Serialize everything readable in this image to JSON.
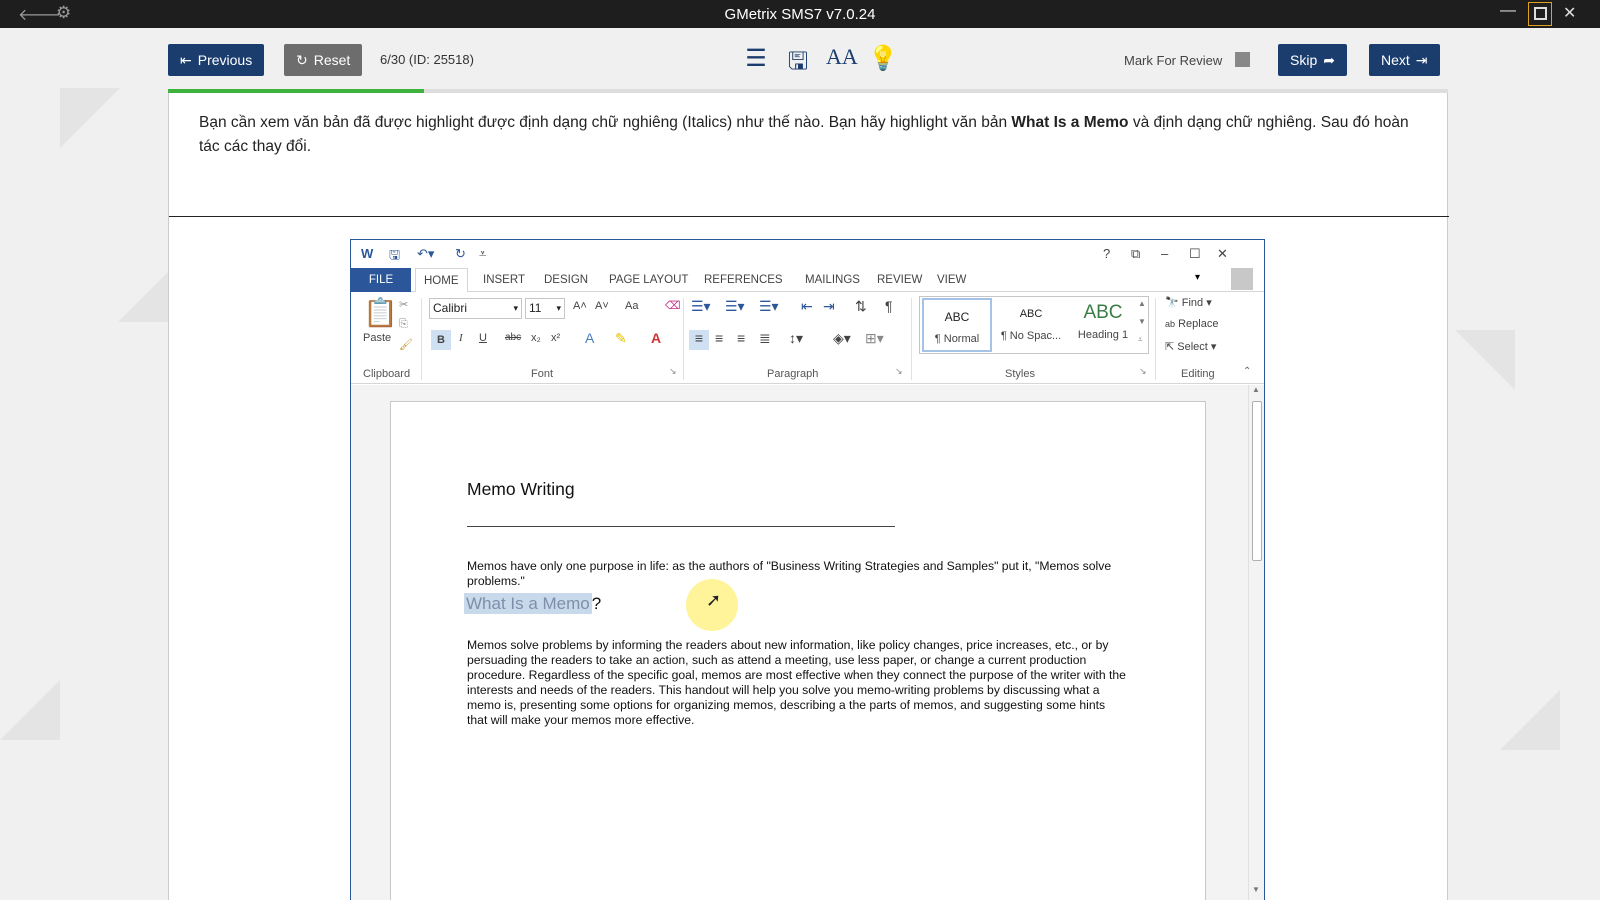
{
  "app": {
    "title": "GMetrix SMS7 v7.0.24"
  },
  "toolbar": {
    "previous_label": "Previous",
    "reset_label": "Reset",
    "question_number": "6/30 (ID: 25518)",
    "mark_for_review_label": "Mark For Review",
    "skip_label": "Skip",
    "next_label": "Next",
    "progress_fraction": 0.2,
    "icons": [
      "list-icon",
      "save-icon",
      "font-size-icon",
      "lightbulb-icon"
    ]
  },
  "question": {
    "text_before": "Bạn cần xem văn bản đã được highlight được định dạng chữ nghiêng (Italics) như thế nào. Bạn hãy highlight văn bản ",
    "text_bold": "What Is a Memo",
    "text_after": " và định dạng chữ nghiêng. Sau đó hoàn tác các thay đổi."
  },
  "word": {
    "help": "?",
    "tabs": [
      "FILE",
      "HOME",
      "INSERT",
      "DESIGN",
      "PAGE LAYOUT",
      "REFERENCES",
      "MAILINGS",
      "REVIEW",
      "VIEW"
    ],
    "active_tab": "HOME",
    "clipboard": {
      "paste": "Paste",
      "label": "Clipboard"
    },
    "font": {
      "name": "Calibri",
      "size": "11",
      "label": "Font",
      "bold": "B",
      "italic": "I",
      "underline": "U",
      "strike": "abc",
      "sub": "x₂",
      "sup": "x²",
      "grow": "A˄",
      "shrink": "A˅",
      "case": "Aa"
    },
    "paragraph": {
      "label": "Paragraph",
      "pilcrow": "¶"
    },
    "styles": {
      "label": "Styles",
      "items": [
        {
          "sample": "ABC",
          "name": "¶ Normal"
        },
        {
          "sample": "ABC",
          "name": "¶ No Spac..."
        },
        {
          "sample": "ABC",
          "name": "Heading 1"
        }
      ]
    },
    "editing": {
      "label": "Editing",
      "find": "Find",
      "replace": "Replace",
      "select": "Select"
    }
  },
  "document": {
    "title": "Memo Writing",
    "intro": "Memos have only one purpose in life: as the authors of \"Business Writing Strategies and Samples\" put it, \"Memos solve problems.\"",
    "heading_selected": "What Is a Memo",
    "heading_tail": "?",
    "body": "Memos solve problems by informing the readers about new information, like policy changes, price increases, etc., or by persuading the readers to take an action, such as attend a meeting, use less paper, or change a current production procedure. Regardless of the specific goal, memos are most effective when they connect the purpose of the writer with the interests and needs of the readers. This handout will help you solve you memo-writing problems by discussing what a memo is, presenting some options for organizing memos, describing a the parts of memos, and suggesting some hints that will make your memos more effective."
  },
  "colors": {
    "brand_dark": "#1b3d6e",
    "progress": "#3db33d",
    "word_blue": "#2b579a",
    "selection": "#c9d9ec",
    "heading_green": "#3a7d44"
  }
}
